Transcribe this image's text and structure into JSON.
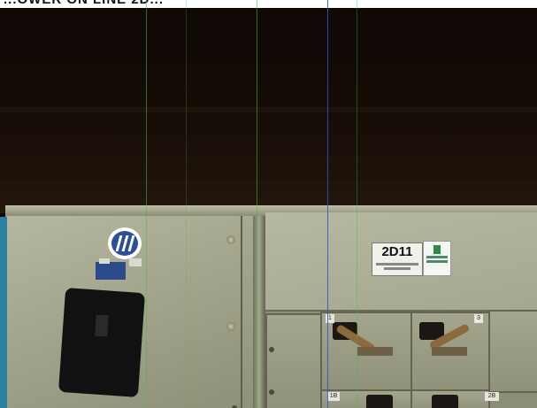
{
  "photo": {
    "top_strip_text": "...OWER ON LINE 2D...",
    "panel_label": "2D11",
    "cell_tags": [
      "1",
      "3",
      "1B",
      "2B"
    ]
  },
  "colors": {
    "ceiling": "#140b06",
    "cabinet": "#a7aa91",
    "logo_blue": "#2b4f9a",
    "label_green": "#2e8a4a",
    "lever_brown": "#8e6a3b",
    "guide_green": "#3fbf3f",
    "guide_blue": "#3a4ad8"
  },
  "icons": [
    "manufacturer-logo-icon",
    "ground-symbol-icon"
  ]
}
